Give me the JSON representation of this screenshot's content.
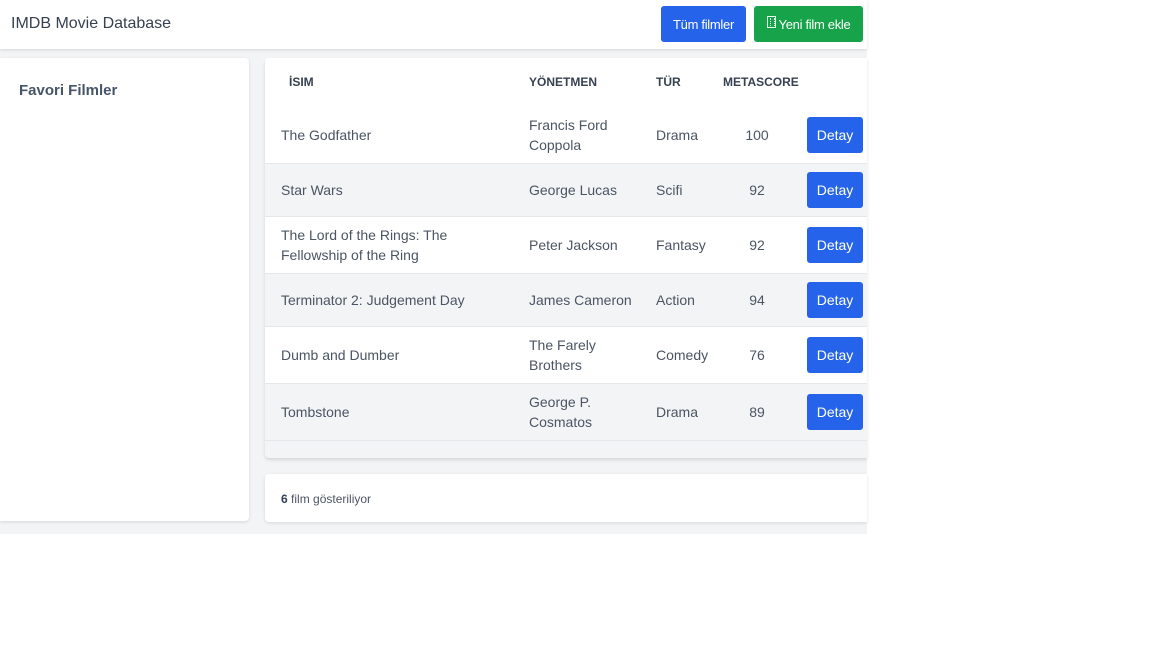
{
  "navbar": {
    "brand": "IMDB Movie Database",
    "all_films_label": "Tüm filmler",
    "new_film_label": "Yeni film ekle",
    "new_film_icon": "film-icon"
  },
  "sidebar": {
    "title": "Favori Filmler"
  },
  "table": {
    "headers": {
      "name": "İSIM",
      "director": "YÖNETMEN",
      "genre": "TÜR",
      "metascore": "METASCORE"
    },
    "rows": [
      {
        "name": "The Godfather",
        "director": "Francis Ford Coppola",
        "genre": "Drama",
        "metascore": "100",
        "action": "Detay"
      },
      {
        "name": "Star Wars",
        "director": "George Lucas",
        "genre": "Scifi",
        "metascore": "92",
        "action": "Detay"
      },
      {
        "name": "The Lord of the Rings: The Fellowship of the Ring",
        "director": "Peter Jackson",
        "genre": "Fantasy",
        "metascore": "92",
        "action": "Detay"
      },
      {
        "name": "Terminator 2: Judgement Day",
        "director": "James Cameron",
        "genre": "Action",
        "metascore": "94",
        "action": "Detay"
      },
      {
        "name": "Dumb and Dumber",
        "director": "The Farely Brothers",
        "genre": "Comedy",
        "metascore": "76",
        "action": "Detay"
      },
      {
        "name": "Tombstone",
        "director": "George P. Cosmatos",
        "genre": "Drama",
        "metascore": "89",
        "action": "Detay"
      }
    ]
  },
  "footer": {
    "count": "6",
    "suffix": " film gösteriliyor"
  },
  "colors": {
    "primary": "#2563eb",
    "success": "#16a34a",
    "background": "#f3f4f6"
  }
}
